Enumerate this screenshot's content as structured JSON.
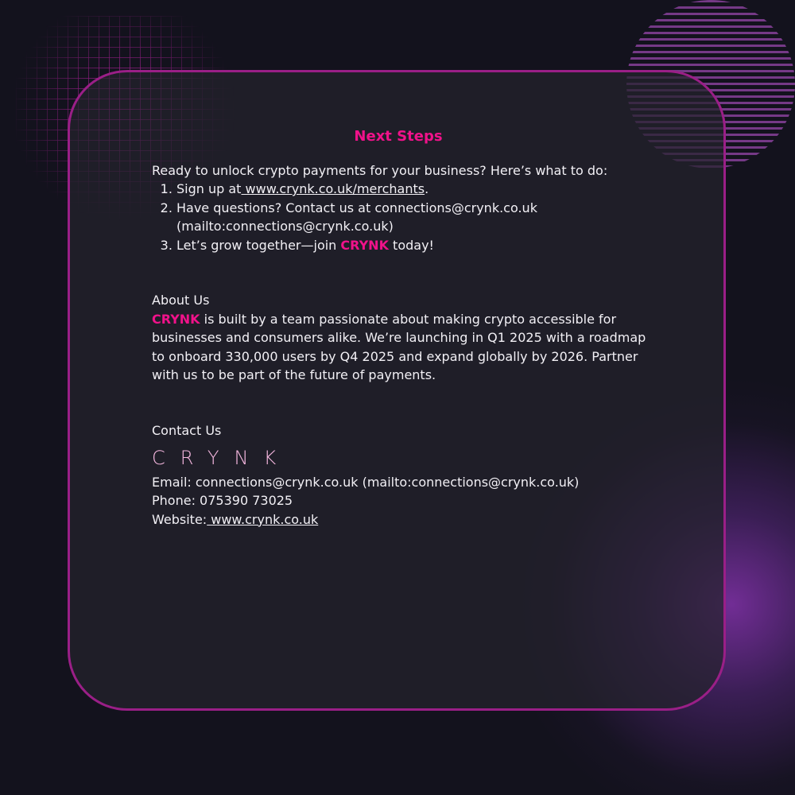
{
  "next_steps": {
    "title": "Next Steps",
    "intro": "Ready to unlock crypto payments for your business? Here’s what to do:",
    "step1_prefix": "Sign up at",
    "step1_link": " www.crynk.co.uk/merchants",
    "step1_suffix": ".",
    "step2": "Have questions? Contact us at connections@crynk.co.uk (mailto:connections@crynk.co.uk)",
    "step3_prefix": "Let’s grow together—join ",
    "step3_brand": "CRYNK",
    "step3_suffix": " today!"
  },
  "about": {
    "heading": "About Us",
    "brand": "CRYNK",
    "text": " is built by a team passionate about making crypto accessible for businesses and consumers alike. We’re launching in Q1 2025 with a roadmap to onboard 330,000 users by Q4 2025 and expand globally by 2026. Partner with us to be part of the future of payments."
  },
  "contact": {
    "heading": "Contact Us",
    "logo": "CRYNK",
    "email": "Email: connections@crynk.co.uk (mailto:connections@crynk.co.uk)",
    "phone": "Phone: 075390 73025",
    "website_label": "Website:",
    "website_link": " www.crynk.co.uk"
  },
  "colors": {
    "accent": "#f0128a",
    "border": "#9a1f87",
    "background": "#13121d"
  }
}
